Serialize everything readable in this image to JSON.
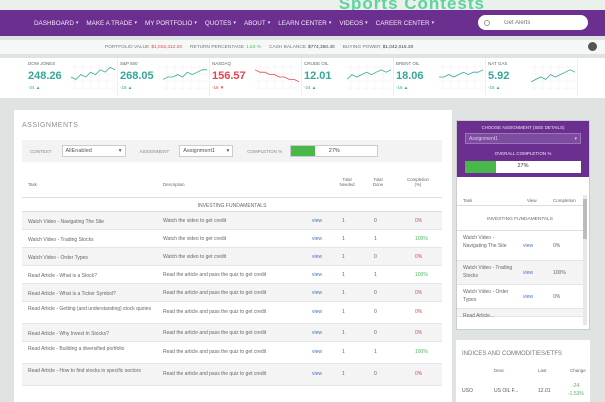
{
  "banner": {
    "text": "Sports Contests"
  },
  "nav": {
    "items": [
      {
        "label": "DASHBOARD",
        "name": "nav-dashboard"
      },
      {
        "label": "MAKE A TRADE",
        "name": "nav-make-a-trade"
      },
      {
        "label": "MY PORTFOLIO",
        "name": "nav-my-portfolio"
      },
      {
        "label": "QUOTES",
        "name": "nav-quotes"
      },
      {
        "label": "ABOUT",
        "name": "nav-about"
      },
      {
        "label": "LEARN CENTER",
        "name": "nav-learn-center"
      },
      {
        "label": "VIDEOS",
        "name": "nav-videos"
      },
      {
        "label": "CAREER CENTER",
        "name": "nav-career-center"
      }
    ],
    "search_placeholder": "Get Alerts"
  },
  "stats": {
    "portfolio_label": "PORTFOLIO VALUE",
    "portfolio_value": "$1,016,312.20",
    "return_label": "RETURN PERCENTAGE",
    "return_value": "1.63 %",
    "cash_label": "CASH BALANCE",
    "cash_value": "$774,350.40",
    "buying_label": "BUYING POWER",
    "buying_value": "$1,042,016.30"
  },
  "tickers": [
    {
      "name": "DOW JONES",
      "price": "248.26",
      "change": "-24 ▲",
      "dir": "up",
      "line": [
        5,
        4,
        6,
        5,
        7,
        6,
        8,
        7,
        9,
        8
      ]
    },
    {
      "name": "S&P 500",
      "price": "268.05",
      "change": "-18 ▲",
      "dir": "up",
      "line": [
        4,
        5,
        5,
        6,
        5,
        7,
        6,
        7,
        8,
        8
      ]
    },
    {
      "name": "NASDAQ",
      "price": "156.57",
      "change": "-16 ▼",
      "dir": "down",
      "line": [
        8,
        7,
        7,
        6,
        6,
        5,
        5,
        4,
        4,
        3
      ]
    },
    {
      "name": "CRUDE OIL",
      "price": "12.01",
      "change": "-24 ▲",
      "dir": "up",
      "line": [
        4,
        6,
        5,
        6,
        7,
        6,
        7,
        8,
        7,
        8
      ]
    },
    {
      "name": "BRENT OIL",
      "price": "18.06",
      "change": "-16 ▲",
      "dir": "up",
      "line": [
        5,
        5,
        6,
        5,
        6,
        7,
        6,
        7,
        7,
        8
      ]
    },
    {
      "name": "NAT GAS",
      "price": "5.92",
      "change": "-16 ▲",
      "dir": "up",
      "line": [
        3,
        4,
        5,
        4,
        6,
        5,
        6,
        7,
        8,
        7
      ]
    }
  ],
  "assignments": {
    "title": "ASSIGNMENTS",
    "contest_label": "CONTEST",
    "contest_value": "AllEnabled",
    "assignment_label": "ASSIGNMENT",
    "assignment_value": "Assignment1",
    "completion_label": "COMPLETION %",
    "completion_text": "27%",
    "completion_value": 0.27,
    "columns": {
      "task": "Task",
      "description": "Description",
      "total_needed": "Total Needed",
      "total_done": "Total Done",
      "completion": "Completion (%)"
    },
    "section": "INVESTING FUNDAMENTALS",
    "rows": [
      {
        "task": "Watch Video - Navigating The Site",
        "desc": "Watch the video to get credit",
        "view": "view",
        "needed": "1",
        "done": "0",
        "pct": "0%"
      },
      {
        "task": "Watch Video - Trading Stocks",
        "desc": "Watch the video to get credit",
        "view": "view",
        "needed": "1",
        "done": "1",
        "pct": "100%"
      },
      {
        "task": "Watch Video - Order Types",
        "desc": "Watch the video to get credit",
        "view": "view",
        "needed": "1",
        "done": "0",
        "pct": "0%"
      },
      {
        "task": "Read Article - What is a Stock?",
        "desc": "Read the article and pass the quiz to get credit",
        "view": "view",
        "needed": "1",
        "done": "1",
        "pct": "100%"
      },
      {
        "task": "Read Article - What is a Ticker Symbol?",
        "desc": "Read the article and pass the quiz to get credit",
        "view": "view",
        "needed": "1",
        "done": "0",
        "pct": "0%"
      },
      {
        "task": "Read Article - Getting (and understanding) stock quotes",
        "desc": "Read the article and pass the quiz to get credit",
        "view": "view",
        "needed": "1",
        "done": "0",
        "pct": "0%"
      },
      {
        "task": "Read Article - Why Invest In Stocks?",
        "desc": "Read the article and pass the quiz to get credit",
        "view": "view",
        "needed": "1",
        "done": "0",
        "pct": "0%"
      },
      {
        "task": "Read Article - Building a diversified portfolio",
        "desc": "Read the article and pass the quiz to get credit",
        "view": "view",
        "needed": "1",
        "done": "1",
        "pct": "100%"
      },
      {
        "task": "Read Article - How to find stocks in specific sectors",
        "desc": "Read the article and pass the quiz to get credit",
        "view": "view",
        "needed": "1",
        "done": "0",
        "pct": "0%"
      }
    ]
  },
  "right_panel": {
    "choose_label": "CHOOSE ASSIGNMENT (SEE DETAILS)",
    "choose_value": "Assignment1",
    "overall_label": "OVERALL COMPLETION %",
    "overall_text": "27%",
    "overall_value": 0.27,
    "columns": {
      "task": "Task",
      "view": "View",
      "completion": "Completion"
    },
    "section": "INVESTING FUNDAMENTALS",
    "rows": [
      {
        "task": "Watch Video - Navigating The Site",
        "view": "view",
        "pct": "0%"
      },
      {
        "task": "Watch Video - Trading Stocks",
        "view": "view",
        "pct": "100%"
      },
      {
        "task": "Watch Video - Order Types",
        "view": "view",
        "pct": "0%"
      },
      {
        "task": "Read Article...",
        "view": "",
        "pct": ""
      }
    ]
  },
  "indices": {
    "title": "INDICES AND COMMODITIES/ETFS",
    "columns": {
      "desc": "Desc",
      "last": "Last",
      "change": "Change"
    },
    "row": {
      "symbol": "USO",
      "desc": "US OIL F...",
      "last": "12.01",
      "change": "-24",
      "change_pct": "-1.53%"
    }
  },
  "colors": {
    "brand": "#6a2f8f",
    "up": "#35a89b",
    "down": "#e2474c",
    "progress": "#48b84a"
  }
}
